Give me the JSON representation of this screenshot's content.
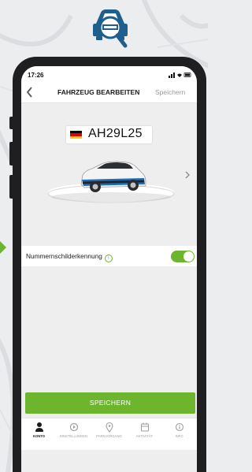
{
  "status_bar": {
    "time": "17:26",
    "icons": "signal wifi battery"
  },
  "nav": {
    "back_icon": "chevron-left-icon",
    "title": "FAHRZEUG BEARBEITEN",
    "save_label": "Speichern"
  },
  "vehicle": {
    "plate_country": "Germany",
    "plate_number": "AH29L25",
    "next_icon": "chevron-right-icon"
  },
  "settings": {
    "plate_recognition_label": "Nummernschilderkennung",
    "plate_recognition_enabled": true
  },
  "save_button_label": "SPEICHERN",
  "tabs": [
    {
      "label": "KONTO",
      "icon": "person-icon",
      "active": true
    },
    {
      "label": "EINSTELLUNGEN",
      "icon": "settings-circle-icon",
      "active": false
    },
    {
      "label": "PARKVORGANG",
      "icon": "location-pin-icon",
      "active": false
    },
    {
      "label": "AKTIVITÄT",
      "icon": "calendar-icon",
      "active": false
    },
    {
      "label": "INFO",
      "icon": "info-icon",
      "active": false
    }
  ],
  "colors": {
    "accent": "#6cb52d",
    "logo_blue": "#1e5f8e",
    "phone_frame": "#1f1f21"
  }
}
